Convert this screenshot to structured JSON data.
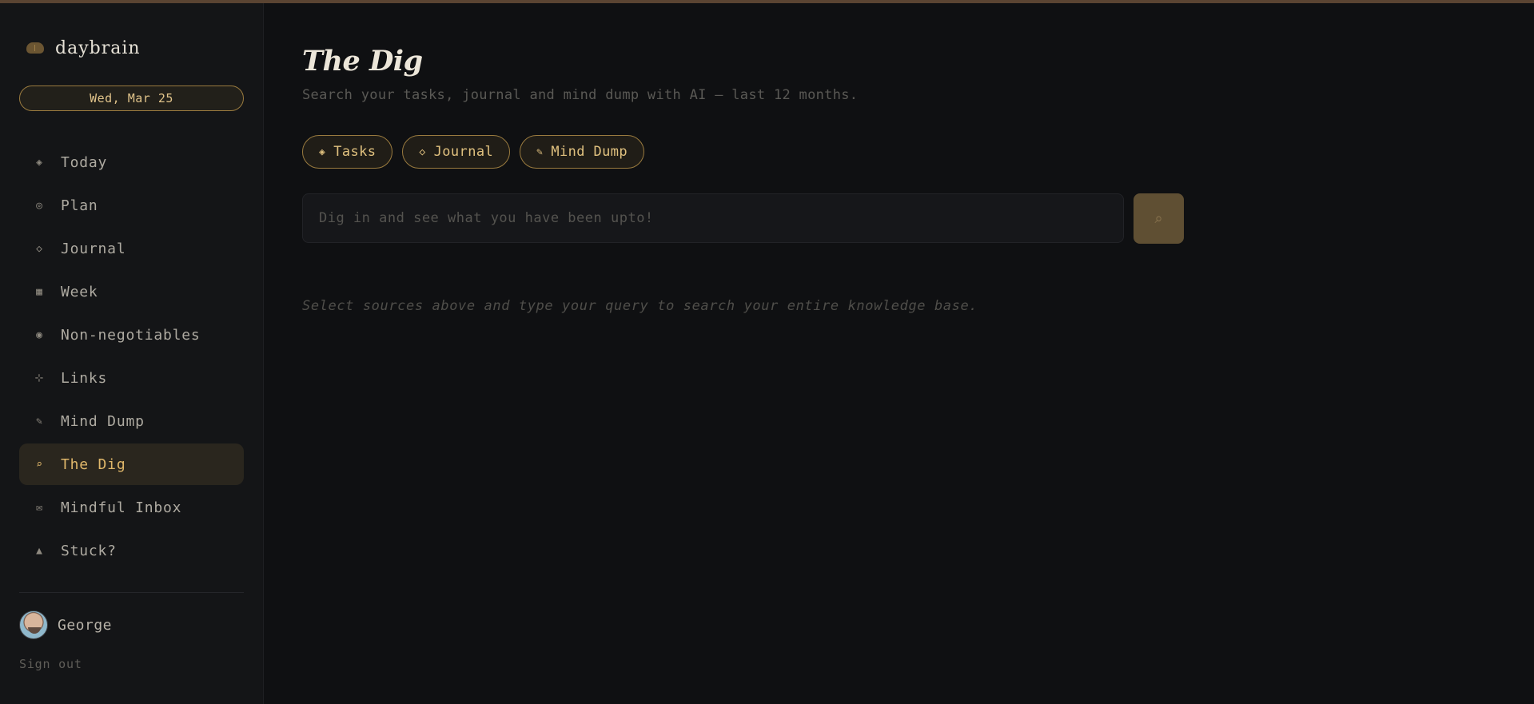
{
  "brand": {
    "name": "daybrain",
    "icon": "brain-icon"
  },
  "date": "Wed, Mar 25",
  "nav": [
    {
      "icon": "◈",
      "label": "Today"
    },
    {
      "icon": "◎",
      "label": "Plan"
    },
    {
      "icon": "◇",
      "label": "Journal"
    },
    {
      "icon": "▦",
      "label": "Week"
    },
    {
      "icon": "◉",
      "label": "Non-negotiables"
    },
    {
      "icon": "⊹",
      "label": "Links"
    },
    {
      "icon": "✎",
      "label": "Mind Dump"
    },
    {
      "icon": "⌕",
      "label": "The Dig"
    },
    {
      "icon": "✉",
      "label": "Mindful Inbox"
    },
    {
      "icon": "▲",
      "label": "Stuck?"
    }
  ],
  "user": {
    "name": "George",
    "signout": "Sign out"
  },
  "main": {
    "title": "The Dig",
    "subtitle": "Search your tasks, journal and mind dump with AI — last 12 months.",
    "chips": [
      {
        "icon": "◈",
        "label": "Tasks"
      },
      {
        "icon": "◇",
        "label": "Journal"
      },
      {
        "icon": "✎",
        "label": "Mind Dump"
      }
    ],
    "search": {
      "placeholder": "Dig in and see what you have been upto!",
      "value": "",
      "button_icon": "⌕"
    },
    "hint": "Select sources above and type your query to search your entire knowledge base."
  },
  "colors": {
    "accent": "#e0b76a",
    "background": "#0f1012",
    "sidebar": "#141517"
  }
}
